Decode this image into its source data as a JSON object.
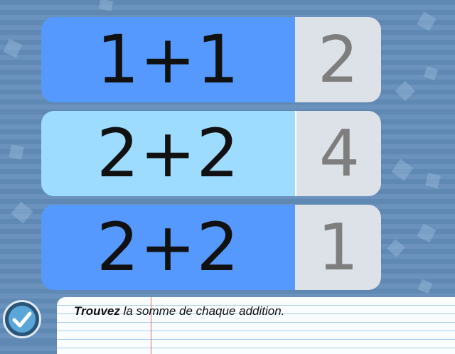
{
  "rows": [
    {
      "expression": "1+1",
      "answer": "2"
    },
    {
      "expression": "2+2",
      "answer": "4"
    },
    {
      "expression": "2+2",
      "answer": "1"
    }
  ],
  "instruction": {
    "bold": "Trouvez",
    "rest": " la somme de chaque addition."
  },
  "icons": {
    "check": "check-icon"
  },
  "colors": {
    "row_dark": "#5599ff",
    "row_light": "#9ddcff",
    "answer_bg": "#dde1e8",
    "background": "#5f88b3"
  }
}
